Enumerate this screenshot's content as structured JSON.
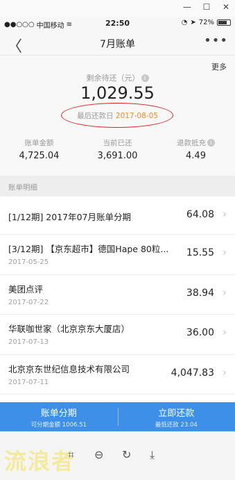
{
  "window": {
    "min_glyph": "—",
    "max_glyph": "☐",
    "close_glyph": "✕"
  },
  "status_bar": {
    "carrier": "中国移动",
    "signal": "●●○○○",
    "wifi": "≋",
    "time": "22:50",
    "battery_text": "72%"
  },
  "nav": {
    "back": "〈",
    "title": "7月账单",
    "more": "•••"
  },
  "summary": {
    "more_link": "更多",
    "remaining_label": "剩余待还（元）",
    "remaining_amount": "1,029.55",
    "due_label": "最后还款日",
    "due_date": "2017-08-05",
    "stats": [
      {
        "label": "账单金额",
        "value": "4,725.04"
      },
      {
        "label": "当前已还",
        "value": "3,691.00"
      },
      {
        "label": "退款抵充",
        "value": "4.49"
      }
    ]
  },
  "section_label": "账单明细",
  "items": [
    {
      "title": "[1/12期] 2017年07月账单分期",
      "date": "",
      "amount": "64.08"
    },
    {
      "title": "[3/12期] 【京东超市】德国Hape 80粒...",
      "date": "2017-05-25",
      "amount": "15.55"
    },
    {
      "title": "美团点评",
      "date": "2017-07-22",
      "amount": "38.94"
    },
    {
      "title": "华联咖世家（北京京东大厦店）",
      "date": "2017-07-13",
      "amount": "36.00"
    },
    {
      "title": "北京京东世纪信息技术有限公司",
      "date": "2017-07-11",
      "amount": "4,047.83"
    }
  ],
  "actions": {
    "installment_label": "账单分期",
    "installment_sub": "可分期金额 1006.51",
    "repay_label": "立即还款",
    "repay_sub": "最低还款 23.04"
  },
  "toolbar": {
    "watermark": "流浪者",
    "crop": "⌗",
    "zoom_out": "⊖",
    "rotate": "↻",
    "download": "⤓"
  },
  "colors": {
    "accent_blue": "#3e8fe8",
    "due_orange": "#f08a24",
    "annotation_red": "#d42020"
  }
}
